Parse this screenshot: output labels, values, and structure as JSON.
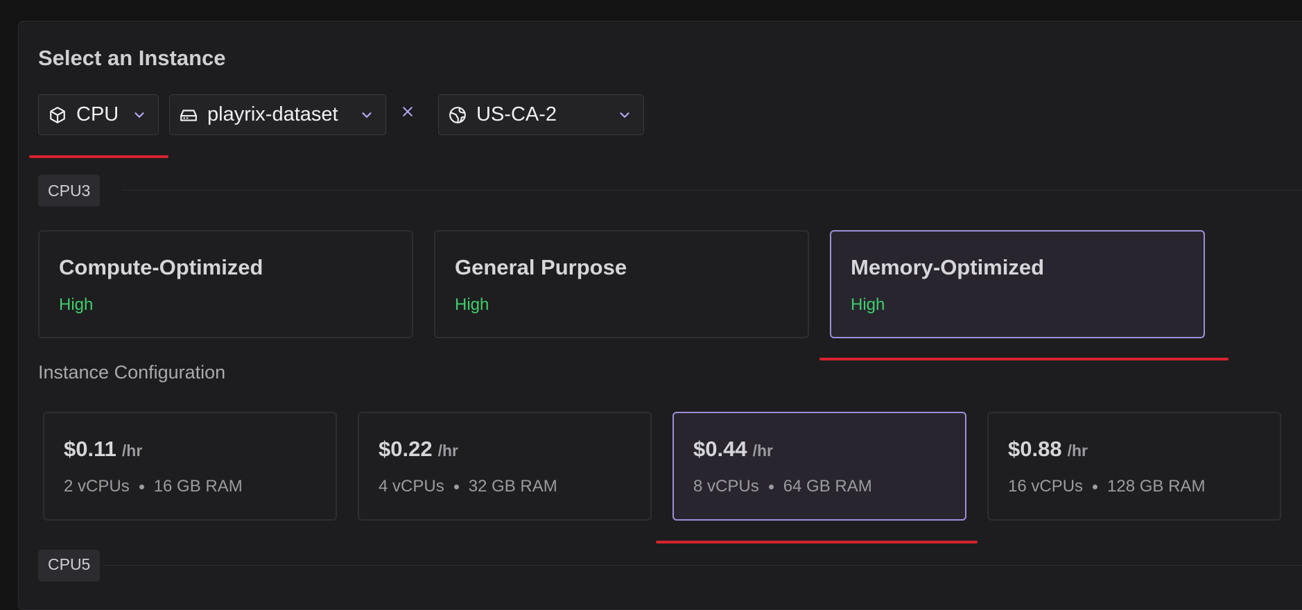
{
  "header": {
    "title": "Select an Instance"
  },
  "filters": {
    "compute": {
      "label": "CPU",
      "icon": "cube-icon"
    },
    "dataset": {
      "label": "playrix-dataset",
      "icon": "hard-drive-icon"
    },
    "clear": {
      "icon": "close-icon"
    },
    "region": {
      "label": "US-CA-2",
      "icon": "globe-icon"
    }
  },
  "groups": [
    {
      "name": "CPU3"
    },
    {
      "name": "CPU5"
    }
  ],
  "instance_types": [
    {
      "name": "Compute-Optimized",
      "level": "High",
      "selected": false
    },
    {
      "name": "General Purpose",
      "level": "High",
      "selected": false
    },
    {
      "name": "Memory-Optimized",
      "level": "High",
      "selected": true
    }
  ],
  "configuration": {
    "label": "Instance Configuration",
    "options": [
      {
        "price": "$0.11",
        "unit": "/hr",
        "vcpus": "2 vCPUs",
        "ram": "16 GB RAM",
        "selected": false
      },
      {
        "price": "$0.22",
        "unit": "/hr",
        "vcpus": "4 vCPUs",
        "ram": "32 GB RAM",
        "selected": false
      },
      {
        "price": "$0.44",
        "unit": "/hr",
        "vcpus": "8 vCPUs",
        "ram": "64 GB RAM",
        "selected": true
      },
      {
        "price": "$0.88",
        "unit": "/hr",
        "vcpus": "16 vCPUs",
        "ram": "128 GB RAM",
        "selected": false
      }
    ]
  },
  "colors": {
    "accent": "#9e8fd9",
    "level_green": "#3ecf6a",
    "annotation_red": "#d8222f"
  }
}
